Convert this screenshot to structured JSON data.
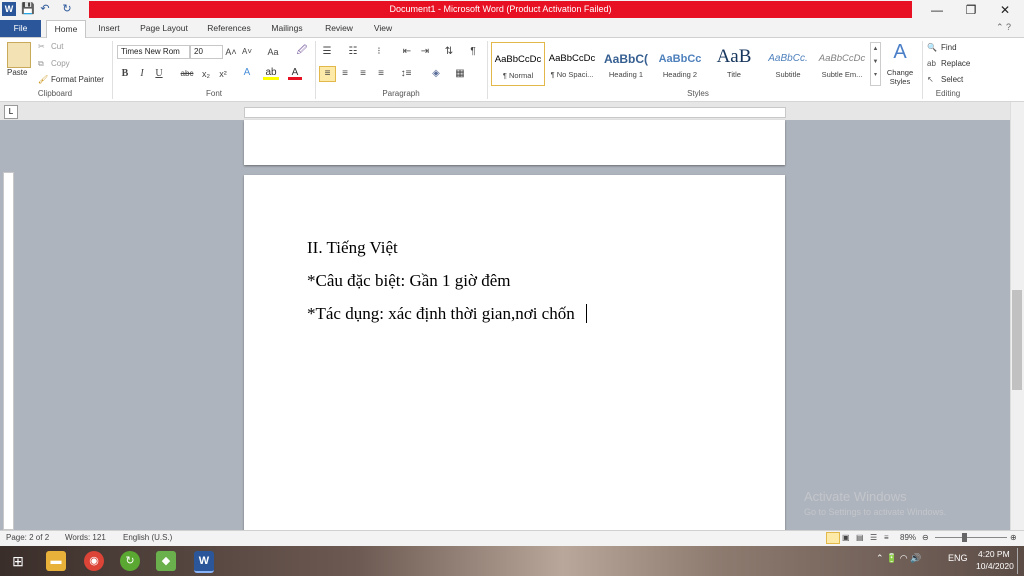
{
  "window": {
    "title": "Document1  -  Microsoft Word (Product Activation Failed)",
    "controls": {
      "minimize": "—",
      "restore": "❐",
      "close": "✕"
    }
  },
  "quick_access": {
    "word_icon": "W",
    "save_icon": "💾",
    "undo_icon": "↶",
    "redo_icon": "↻"
  },
  "tabs": [
    "File",
    "Home",
    "Insert",
    "Page Layout",
    "References",
    "Mailings",
    "Review",
    "View"
  ],
  "clipboard": {
    "paste": "Paste",
    "cut": "Cut",
    "copy": "Copy",
    "format_painter": "Format Painter",
    "label": "Clipboard"
  },
  "font": {
    "family": "Times New Rom",
    "size": "20",
    "bold": "B",
    "italic": "I",
    "underline": "U",
    "strike": "abc",
    "sub": "x₂",
    "sup": "x²",
    "grow": "A˄",
    "shrink": "A˅",
    "case": "Aa",
    "label": "Font"
  },
  "paragraph": {
    "label": "Paragraph",
    "pilcrow": "¶"
  },
  "styles": {
    "label": "Styles",
    "items": [
      {
        "sample": "AaBbCcDc",
        "name": "¶ Normal"
      },
      {
        "sample": "AaBbCcDc",
        "name": "¶ No Spaci..."
      },
      {
        "sample": "AaBbC(",
        "name": "Heading 1"
      },
      {
        "sample": "AaBbCc",
        "name": "Heading 2"
      },
      {
        "sample": "AaB",
        "name": "Title"
      },
      {
        "sample": "AaBbCc.",
        "name": "Subtitle"
      },
      {
        "sample": "AaBbCcDc",
        "name": "Subtle Em..."
      }
    ],
    "change_styles": "Change Styles"
  },
  "editing": {
    "find": "Find",
    "replace": "Replace",
    "select": "Select",
    "label": "Editing"
  },
  "document": {
    "lines": [
      "II. Tiếng Việt",
      "*Câu đặc biệt: Gần 1 giờ đêm",
      "*Tác dụng: xác định thời gian,nơi chốn"
    ]
  },
  "watermark": {
    "line1": "Activate Windows",
    "line2": "Go to Settings to activate Windows."
  },
  "status": {
    "page": "Page: 2 of 2",
    "words": "Words: 121",
    "language": "English (U.S.)",
    "zoom": "89%"
  },
  "taskbar": {
    "language": "ENG",
    "time": "4:20 PM",
    "date": "10/4/2020"
  }
}
